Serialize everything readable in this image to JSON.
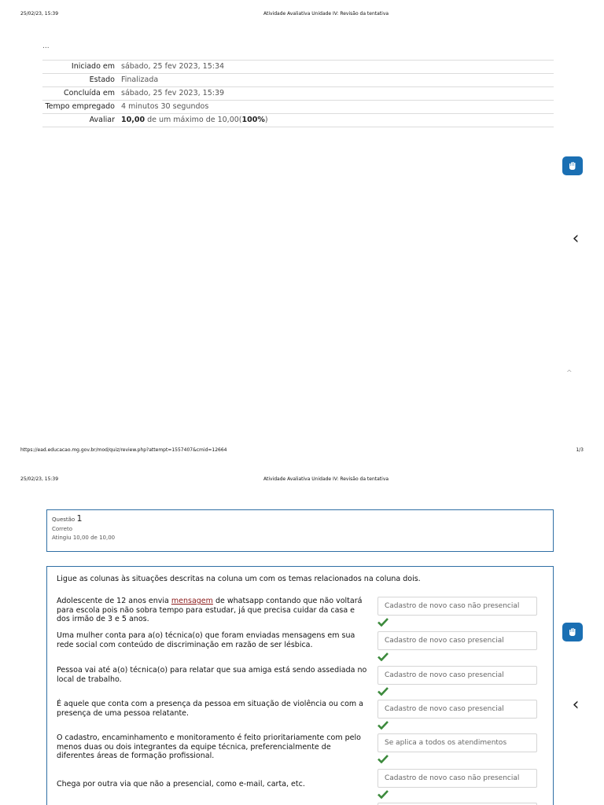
{
  "print": {
    "date": "25/02/23, 15:39",
    "title": "Atividade Avaliativa Unidade IV: Revisão da tentativa",
    "url": "https://ead.educacao.mg.gov.br/mod/quiz/review.php?attempt=1557407&cmid=12664",
    "page": "1/3"
  },
  "ellipsis": "...",
  "summary": [
    {
      "label": "Iniciado em",
      "value": "sábado, 25 fev 2023, 15:34"
    },
    {
      "label": "Estado",
      "value": "Finalizada"
    },
    {
      "label": "Concluída em",
      "value": "sábado, 25 fev 2023, 15:39"
    },
    {
      "label": "Tempo empregado",
      "value": "4 minutos 30 segundos"
    }
  ],
  "grade": {
    "label": "Avaliar",
    "score": "10,00",
    "middle": " de um máximo de 10,00(",
    "percent": "100%",
    "end": ")"
  },
  "question": {
    "prefix": "Questão",
    "number": "1",
    "status": "Correto",
    "points": "Atingiu 10,00 de 10,00",
    "text": "Ligue as colunas às situações descritas na coluna um com os temas relacionados na coluna dois.",
    "stem1_a": "Adolescente de  12 anos envia ",
    "stem1_link": "mensagem",
    "stem1_b": " de whatsapp contando que não voltará para escola pois não sobra tempo para estudar, já que precisa cuidar da casa e dos irmão de 3 e 5 anos.",
    "stem2": "Uma mulher conta para a(o) técnica(o) que foram enviadas mensagens em sua rede social com conteúdo de discriminação em razão de ser lésbica.",
    "stem3": "Pessoa vai até a(o) técnica(o) para relatar que sua amiga está sendo assediada no local de trabalho.",
    "stem4": "É aquele que conta com a presença da pessoa em situação de violência ou com a presença de uma pessoa relatante.",
    "stem5": "O cadastro, encaminhamento e monitoramento é feito prioritariamente com pelo menos duas ou dois integrantes da equipe técnica, preferencialmente de diferentes áreas de formação profissional.",
    "stem6": "Chega por outra via que não a presencial, como e-mail, carta, etc.",
    "answers": [
      "Cadastro de novo caso não presencial",
      "Cadastro de novo caso presencial",
      "Cadastro de novo caso presencial",
      "Cadastro de novo caso presencial",
      "Se aplica a todos os atendimentos",
      "Cadastro de novo caso não presencial"
    ]
  },
  "colors": {
    "accent": "#2f6fa5",
    "check": "#3c8a3c",
    "badge": "#1a6fb3"
  }
}
